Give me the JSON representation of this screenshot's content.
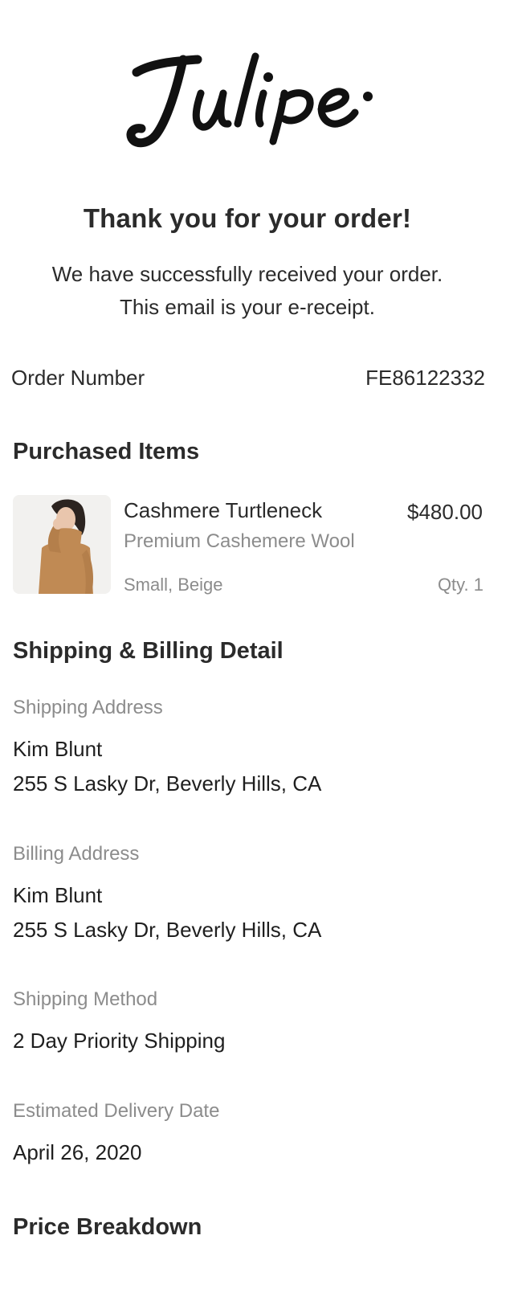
{
  "brand": {
    "logo_text": "Julipe."
  },
  "header": {
    "title": "Thank you for your order!",
    "message_lines": [
      "We have successfully received your order.",
      "This email is your e-receipt."
    ]
  },
  "order": {
    "number_label": "Order Number",
    "number_value": "FE86122332"
  },
  "purchased": {
    "title": "Purchased Items",
    "items": [
      {
        "name": "Cashmere Turtleneck",
        "price": "$480.00",
        "description": "Premium Cashemere Wool",
        "variant": "Small, Beige",
        "quantity": "Qty. 1"
      }
    ]
  },
  "details": {
    "title": "Shipping & Billing Detail",
    "shipping_address": {
      "label": "Shipping Address",
      "name": "Kim Blunt",
      "address": "255 S Lasky Dr, Beverly Hills, CA"
    },
    "billing_address": {
      "label": "Billing Address",
      "name": "Kim Blunt",
      "address": "255 S Lasky Dr, Beverly Hills, CA"
    },
    "shipping_method": {
      "label": "Shipping Method",
      "value": "2 Day Priority Shipping"
    },
    "delivery_date": {
      "label": "Estimated Delivery Date",
      "value": "April 26, 2020"
    }
  },
  "price_breakdown": {
    "title": "Price Breakdown"
  },
  "colors": {
    "text": "#2b2b2b",
    "muted": "#8c8c8c",
    "sweater": "#c08a54",
    "background": "#ffffff"
  }
}
